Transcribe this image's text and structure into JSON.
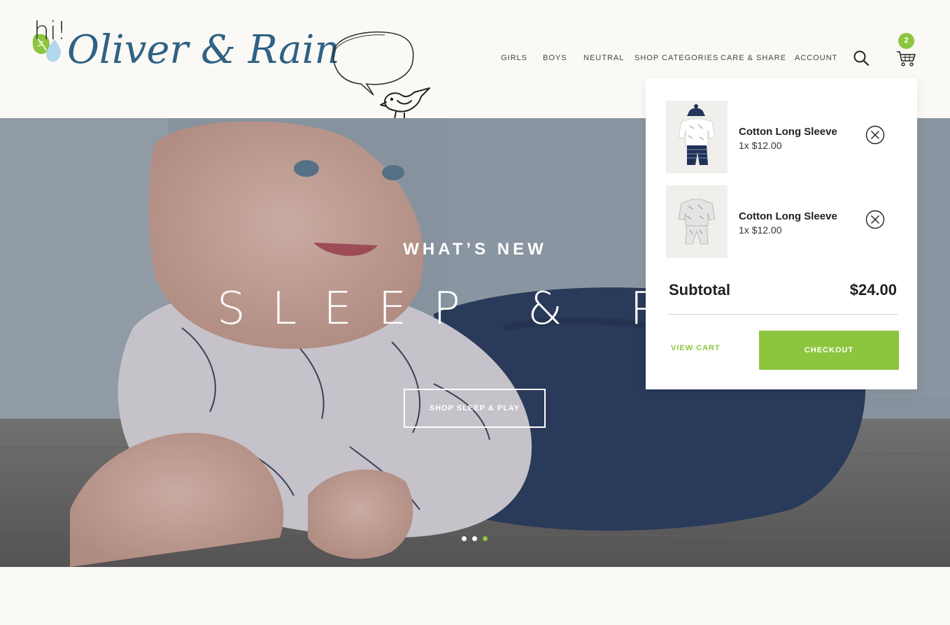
{
  "brand": {
    "name": "Oliver & Rain",
    "bubble_text": "hi!",
    "accent_color": "#8cc63f",
    "logo_color": "#2f6284"
  },
  "nav": {
    "items": [
      {
        "label": "GIRLS"
      },
      {
        "label": "BOYS"
      },
      {
        "label": "NEUTRAL"
      },
      {
        "label": "SHOP CATEGORIES"
      },
      {
        "label": "CARE & SHARE"
      },
      {
        "label": "ACCOUNT"
      }
    ],
    "search_icon": "search-icon",
    "cart_icon": "cart-icon",
    "cart_count": "2"
  },
  "hero": {
    "kicker": "WHAT’S NEW",
    "title": "SLEEP & PL",
    "cta_label": "SHOP SLEEP & PLAY",
    "slides": 3,
    "active_slide": 3
  },
  "cart": {
    "items": [
      {
        "name": "Cotton Long Sleeve",
        "qty_price": "1x $12.00",
        "remove_icon": "remove-circle-icon"
      },
      {
        "name": "Cotton Long Sleeve",
        "qty_price": "1x $12.00",
        "remove_icon": "remove-circle-icon"
      }
    ],
    "subtotal_label": "Subtotal",
    "subtotal_value": "$24.00",
    "view_cart_label": "VIEW CART",
    "checkout_label": "CHECKOUT"
  }
}
